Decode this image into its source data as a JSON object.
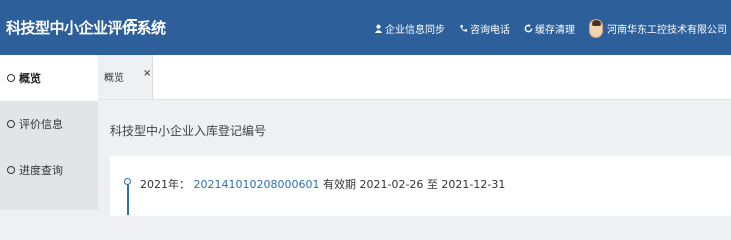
{
  "app": {
    "title": "科技型中小企业评价系统"
  },
  "topbar": {
    "actions": [
      {
        "label": "企业信息同步",
        "icon": "user-icon"
      },
      {
        "label": "咨询电话",
        "icon": "phone-icon"
      },
      {
        "label": "缓存清理",
        "icon": "refresh-icon"
      }
    ],
    "company": "河南华东工控技术有限公司"
  },
  "sidebar": {
    "items": [
      {
        "label": "概览",
        "active": true
      },
      {
        "label": "评价信息",
        "active": false
      },
      {
        "label": "进度查询",
        "active": false
      }
    ]
  },
  "tabs": [
    {
      "label": "概览",
      "close": "×"
    }
  ],
  "main": {
    "section_title": "科技型中小企业入库登记编号",
    "records": [
      {
        "year_label": "2021年：",
        "code": "202141010208000601",
        "validity_label": "有效期",
        "start": "2021-02-26",
        "sep": "至",
        "end": "2021-12-31"
      }
    ]
  },
  "colors": {
    "header": "#2d5f9a",
    "accent": "#2d6eb5",
    "background": "#eef0f3"
  }
}
